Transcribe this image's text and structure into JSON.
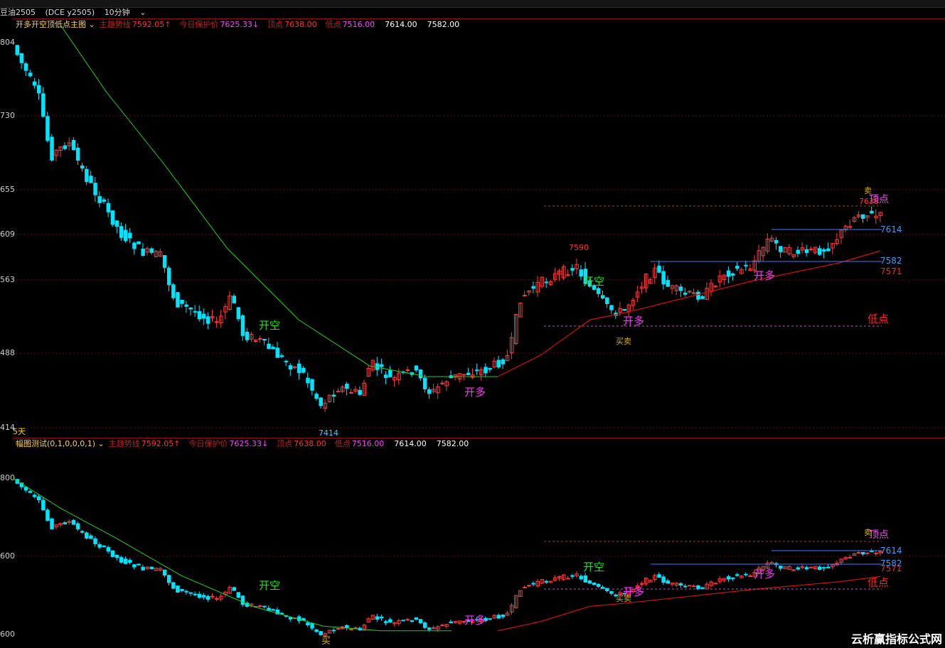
{
  "symbol": {
    "name": "豆油2505",
    "exchange_code": "(DCE  y2505)",
    "period": "10分钟"
  },
  "panel1": {
    "title": "开多开空顶低点主图",
    "indicators": [
      {
        "label": "主趋势线",
        "value": "7592.05↑",
        "color": "#ff3030"
      },
      {
        "label": "今日保护价",
        "value": "7625.33↓",
        "color": "#ff40ff"
      },
      {
        "label": "顶点",
        "value": "7638.00",
        "color": "#ff3030"
      },
      {
        "label": "低点",
        "value": "7516.00",
        "color": "#ff40ff"
      },
      {
        "label": "",
        "value": "7614.00",
        "color": "#ffffff"
      },
      {
        "label": "",
        "value": "7582.00",
        "color": "#ffffff"
      }
    ],
    "axis_labels": [
      "804",
      "730",
      "655",
      "609",
      "563",
      "488",
      "414"
    ],
    "footer_label": "5天",
    "annotations": {
      "low_price": "7414",
      "peak_price": "7590",
      "top_price": "7638",
      "kaikong": "开空",
      "kaiduo": "开多",
      "top": "顶点",
      "bottom": "低点",
      "buy": "买",
      "sell": "卖",
      "line_7614": "7614",
      "line_7582": "7582",
      "line_7571": "7571"
    }
  },
  "panel2": {
    "title": "幅图测试(0,1,0,0,0,1)",
    "axis_labels": [
      "800",
      "600",
      "600"
    ]
  },
  "watermark": "云析赢指标公式网",
  "colors": {
    "up": "#ff3b3b",
    "down": "#00e5ff",
    "grid": "#8a1010",
    "ma_green": "#1fd01f",
    "ma_red": "#d01010"
  }
}
